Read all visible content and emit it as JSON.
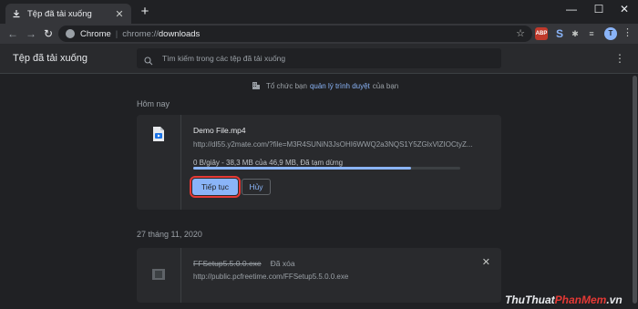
{
  "tab": {
    "title": "Tệp đã tải xuống",
    "close": "✕",
    "new_tab": "+"
  },
  "window_controls": {
    "minimize": "—",
    "maximize": "☐",
    "close": "✕"
  },
  "toolbar": {
    "back": "←",
    "forward": "→",
    "reload": "↻",
    "omnibox": {
      "site": "Chrome",
      "separator": "|",
      "scheme": "chrome://",
      "path": "downloads"
    },
    "star": "☆",
    "extensions": {
      "abp": "ABP",
      "s": "S",
      "puzzle": "✱",
      "list": "≡"
    },
    "avatar_letter": "T",
    "menu": "⋮"
  },
  "downloads": {
    "title": "Tệp đã tải xuống",
    "search_placeholder": "Tìm kiếm trong các tệp đã tải xuống",
    "menu": "⋮",
    "managed_notice": {
      "prefix": "Tổ chức bạn",
      "link": "quản lý trình duyệt",
      "suffix": "của bạn"
    },
    "groups": [
      {
        "date": "Hôm nay",
        "item": {
          "name": "Demo File.mp4",
          "url": "http://dl55.y2mate.com/?file=M3R4SUNiN3JsOHI6WWQ2a3NQS1Y5ZGlxVlZIOCtyZ...",
          "status": "0 B/giây - 38,3 MB của 46,9 MB, Đã tạm dừng",
          "progress_percent": 81.7,
          "resume_label": "Tiếp tục",
          "cancel_label": "Hủy"
        }
      },
      {
        "date": "27 tháng 11, 2020",
        "item": {
          "name": "FFSetup5.5.0.0.exe",
          "removed_label": "Đã xóa",
          "url": "http://public.pcfreetime.com/FFSetup5.5.0.0.exe",
          "close": "✕"
        }
      }
    ]
  },
  "watermark": {
    "part1": "ThuThuat",
    "part2": "PhanMem",
    "part3": ".vn"
  },
  "colors": {
    "accent": "#8ab4f8",
    "highlight": "#e53935",
    "background": "#202124",
    "card": "#292a2d"
  }
}
